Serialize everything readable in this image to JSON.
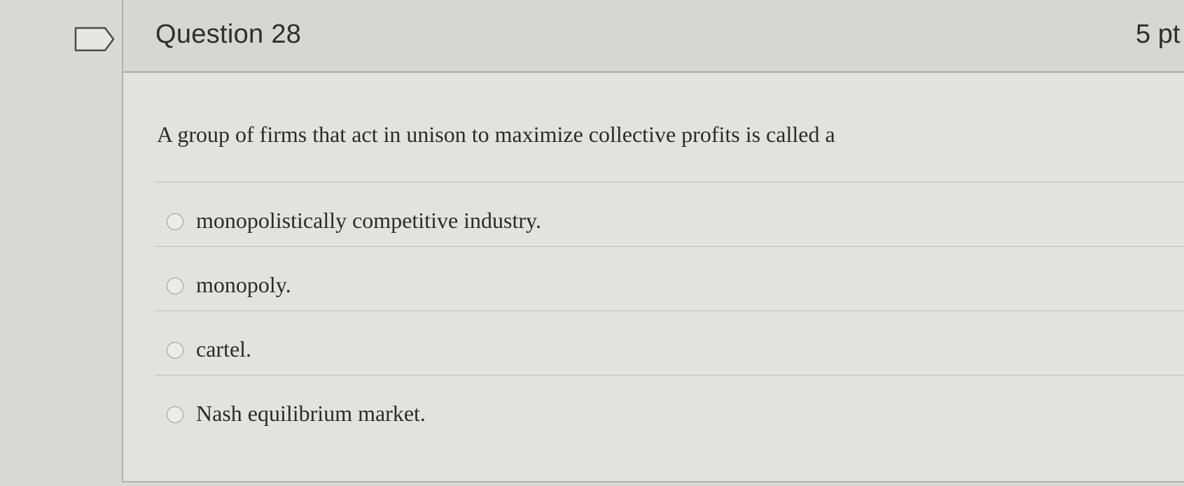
{
  "question": {
    "title": "Question 28",
    "points": "5 pt",
    "flag_icon": "flag-outline-icon",
    "text": "A group of firms that act in unison to maximize collective profits is called a",
    "options": [
      {
        "label": "monopolistically competitive industry.",
        "selected": false
      },
      {
        "label": "monopoly.",
        "selected": false
      },
      {
        "label": "cartel.",
        "selected": false
      },
      {
        "label": "Nash equilibrium market.",
        "selected": false
      }
    ]
  },
  "colors": {
    "page_background": "#d9d9d7",
    "header_background": "#d6d6d4",
    "text": "#2b2b2b"
  }
}
